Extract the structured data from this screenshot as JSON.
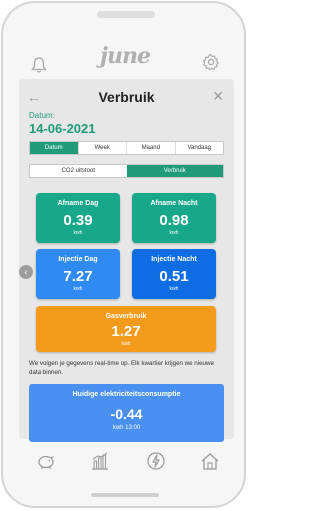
{
  "app": {
    "logo_text": "june"
  },
  "header": {
    "title": "Verbruik",
    "back_glyph": "←",
    "close_glyph": "✕"
  },
  "date": {
    "label": "Datum:",
    "value": "14-06-2021"
  },
  "period_tabs": [
    "Datum",
    "Week",
    "Maand",
    "Vandaag"
  ],
  "period_tabs_active": 0,
  "mode_tabs": [
    "CO2 uitstoot",
    "Verbruik"
  ],
  "mode_tabs_active": 1,
  "cards": {
    "afname_dag": {
      "label": "Afname Dag",
      "value": "0.39",
      "unit": "kwh"
    },
    "afname_nacht": {
      "label": "Afname Nacht",
      "value": "0.98",
      "unit": "kwh"
    },
    "injectie_dag": {
      "label": "Injectie Dag",
      "value": "7.27",
      "unit": "kwh"
    },
    "injectie_nacht": {
      "label": "Injectie Nacht",
      "value": "0.51",
      "unit": "kwh"
    },
    "gas": {
      "label": "Gasverbruik",
      "value": "1.27",
      "unit": "kwh"
    }
  },
  "info_text": "We volgen je gegevens real-time op. Elk kwartier krijgen we nieuwe data binnen.",
  "realtime": {
    "label": "Huidige elektriciteitsconsumptie",
    "value": "-0.44",
    "sub": "kwh  13:00"
  },
  "icons": {
    "bell": "bell-icon",
    "settings": "gear-icon",
    "back": "arrow-left-icon",
    "close": "close-icon",
    "prev": "chevron-left-icon",
    "tab_savings": "piggy-bank-icon",
    "tab_stats": "bar-chart-icon",
    "tab_energy": "lightning-icon",
    "tab_home": "house-icon"
  },
  "colors": {
    "accent": "#1f9b78",
    "teal_card": "#17a88b",
    "blue_card": "#2f8af4",
    "blue_card_dark": "#0f6de3",
    "orange_card": "#f49b1c",
    "realtime_card": "#4a90f0"
  }
}
